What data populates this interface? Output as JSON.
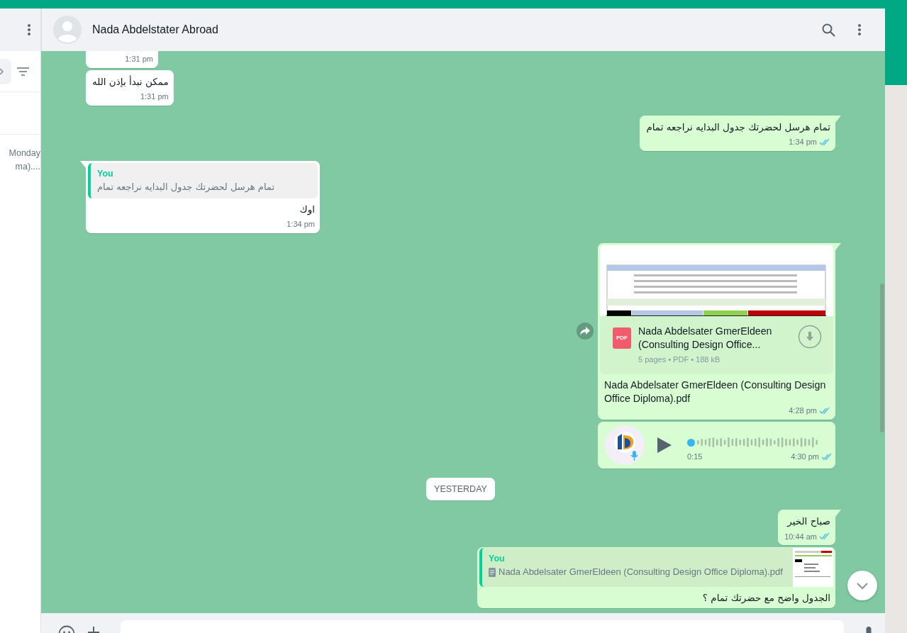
{
  "sidebar": {
    "items": [
      {
        "time": "Monday",
        "preview": "ma)...."
      }
    ]
  },
  "chat": {
    "title": "Nada Abdelstater Abroad"
  },
  "messages": [
    {
      "kind": "text",
      "outgoing": false,
      "time": "1:31 pm"
    },
    {
      "kind": "text",
      "outgoing": false,
      "text": "ممكن نبدأ بإذن الله",
      "time": "1:31 pm"
    },
    {
      "kind": "text",
      "outgoing": true,
      "text": "تمام هرسل لحضرتك جدول البدايه نراجعه تمام",
      "time": "1:34 pm",
      "read": true
    },
    {
      "kind": "reply",
      "outgoing": false,
      "quote": {
        "author": "You",
        "text": "تمام هرسل لحضرتك جدول البدايه نراجعه تمام"
      },
      "text": "اوك",
      "time": "1:34 pm"
    },
    {
      "kind": "document",
      "outgoing": true,
      "file_badge": "PDF",
      "file_name": "Nada Abdelsater GmerEldeen (Consulting Design Office...",
      "meta": "5 pages • PDF • 188 kB",
      "caption": "Nada Abdelsater GmerEldeen (Consulting Design Office Diploma).pdf",
      "time": "4:28 pm",
      "read": true
    },
    {
      "kind": "audio",
      "outgoing": true,
      "duration": "0:15",
      "time": "4:30 pm",
      "read": true
    },
    {
      "kind": "date",
      "text": "YESTERDAY"
    },
    {
      "kind": "text",
      "outgoing": true,
      "text": "صباح الخير",
      "time": "10:44 am",
      "read": true
    },
    {
      "kind": "reply",
      "outgoing": true,
      "quote": {
        "author": "You",
        "text": "Nada Abdelsater GmerEldeen (Consulting Design Office Diploma).pdf",
        "has_file": true
      },
      "text": "الجدول واضح مع حضرتك تمام ؟"
    }
  ]
}
